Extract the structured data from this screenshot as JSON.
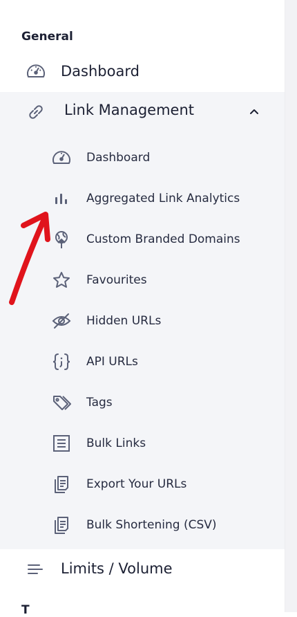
{
  "sections": {
    "general": "General",
    "next": "T"
  },
  "nav": {
    "dashboard": {
      "label": "Dashboard",
      "icon": "gauge-icon"
    },
    "link_management": {
      "label": "Link Management",
      "icon": "link-icon",
      "expanded": true,
      "items": [
        {
          "label": "Dashboard",
          "icon": "gauge-icon"
        },
        {
          "label": "Aggregated Link Analytics",
          "icon": "bar-chart-icon"
        },
        {
          "label": "Custom Branded Domains",
          "icon": "globe-upload-icon"
        },
        {
          "label": "Favourites",
          "icon": "star-icon"
        },
        {
          "label": "Hidden URLs",
          "icon": "eye-off-icon"
        },
        {
          "label": "API URLs",
          "icon": "code-braces-icon"
        },
        {
          "label": "Tags",
          "icon": "tags-icon"
        },
        {
          "label": "Bulk Links",
          "icon": "list-box-icon"
        },
        {
          "label": "Export Your URLs",
          "icon": "document-copy-icon"
        },
        {
          "label": "Bulk Shortening (CSV)",
          "icon": "document-copy-icon"
        }
      ]
    },
    "limits": {
      "label": "Limits / Volume",
      "icon": "lines-icon"
    }
  },
  "colors": {
    "icon": "#5b6178",
    "group_bg": "#f4f5f8",
    "annotation_arrow": "#e0141c"
  }
}
